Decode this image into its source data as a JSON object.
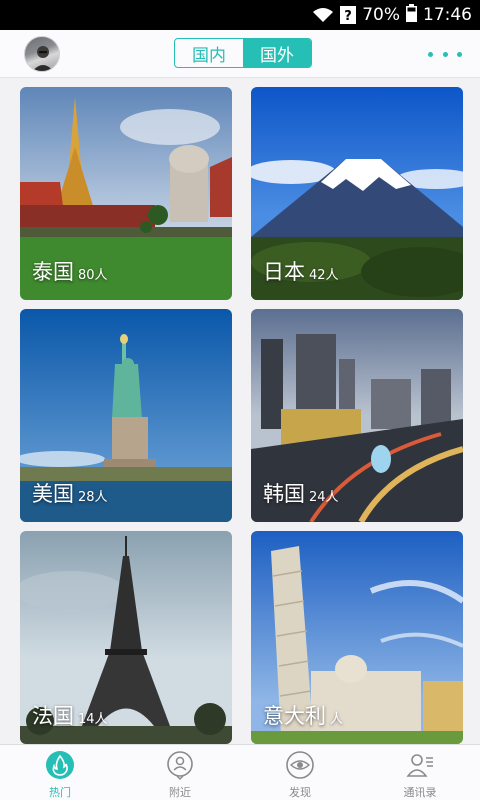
{
  "status_bar": {
    "battery": "70%",
    "time": "17:46"
  },
  "header": {
    "segments": [
      {
        "label": "国内",
        "active": false
      },
      {
        "label": "国外",
        "active": true
      }
    ]
  },
  "destinations": [
    {
      "name": "泰国",
      "count": "80人"
    },
    {
      "name": "日本",
      "count": "42人"
    },
    {
      "name": "美国",
      "count": "28人"
    },
    {
      "name": "韩国",
      "count": "24人"
    },
    {
      "name": "法国",
      "count": "14人"
    },
    {
      "name": "意大利",
      "count": "人"
    }
  ],
  "tabs": [
    {
      "label": "热门",
      "icon": "flame-icon",
      "active": true
    },
    {
      "label": "附近",
      "icon": "person-pin-icon",
      "active": false
    },
    {
      "label": "发现",
      "icon": "eye-icon",
      "active": false
    },
    {
      "label": "通讯录",
      "icon": "contacts-icon",
      "active": false
    }
  ],
  "colors": {
    "accent": "#26bfb5",
    "background": "#f2f2f4"
  }
}
